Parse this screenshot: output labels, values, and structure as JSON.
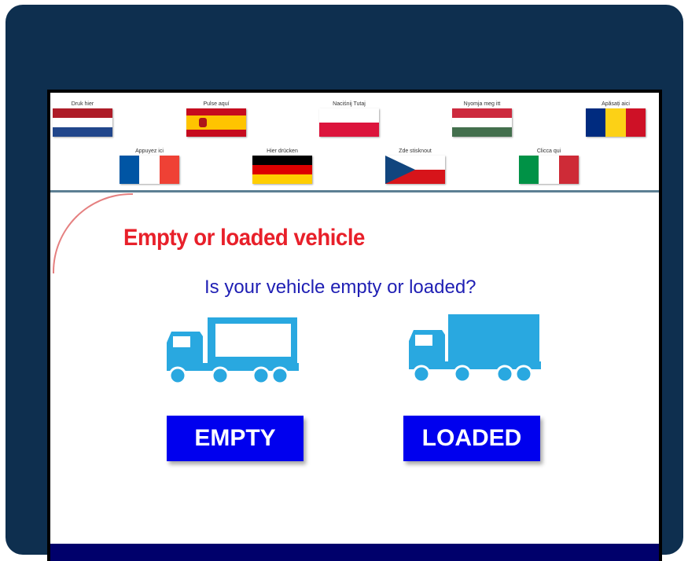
{
  "languages": [
    {
      "label": "Druk hier",
      "flag": "netherlands",
      "colors": [
        "#ae1c28",
        "#ffffff",
        "#21468b"
      ]
    },
    {
      "label": "Pulse aquí",
      "flag": "spain",
      "colors": [
        "#c60b1e",
        "#ffc400"
      ]
    },
    {
      "label": "Naciśnij Tutaj",
      "flag": "poland",
      "colors": [
        "#ffffff",
        "#dc143c"
      ]
    },
    {
      "label": "Nyomja meg itt",
      "flag": "hungary",
      "colors": [
        "#cd2a3e",
        "#ffffff",
        "#436f4d"
      ]
    },
    {
      "label": "Apăsați aici",
      "flag": "romania",
      "colors": [
        "#002b7f",
        "#fcd116",
        "#ce1126"
      ]
    },
    {
      "label": "Appuyez ici",
      "flag": "france",
      "colors": [
        "#0055a4",
        "#ffffff",
        "#ef4135"
      ]
    },
    {
      "label": "Hier drücken",
      "flag": "germany",
      "colors": [
        "#000000",
        "#dd0000",
        "#ffce00"
      ]
    },
    {
      "label": "Zde stisknout",
      "flag": "czech-republic",
      "colors": [
        "#11457e",
        "#ffffff",
        "#d7141a"
      ]
    },
    {
      "label": "Clicca qui",
      "flag": "italy",
      "colors": [
        "#009246",
        "#ffffff",
        "#ce2b37"
      ]
    }
  ],
  "page": {
    "title": "Empty or loaded vehicle",
    "question": "Is your vehicle empty or loaded?"
  },
  "options": {
    "empty_label": "EMPTY",
    "loaded_label": "LOADED",
    "empty_icon": "empty-truck-icon",
    "loaded_icon": "loaded-truck-icon"
  },
  "colors": {
    "frame": "#0e2f4f",
    "title": "#e8202a",
    "question": "#1f1fb4",
    "button": "#0000ee",
    "truck": "#29a8e0",
    "bottom_bar": "#00006b"
  }
}
